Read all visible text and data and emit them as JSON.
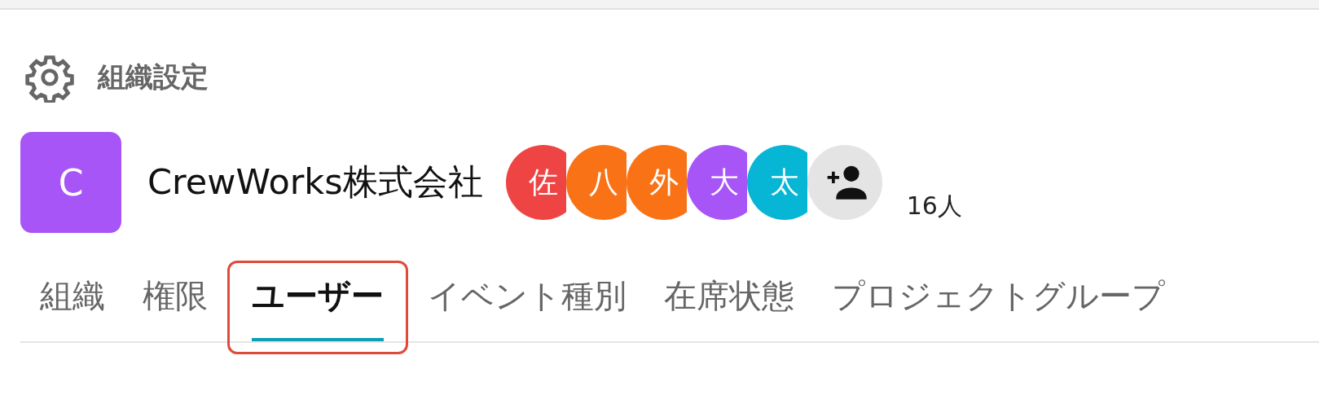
{
  "header": {
    "title": "組織設定"
  },
  "organization": {
    "logo_letter": "C",
    "name": "CrewWorks株式会社",
    "member_count": "16人"
  },
  "members": [
    {
      "initial": "佐",
      "color": "#ef4444"
    },
    {
      "initial": "八",
      "color": "#f97316"
    },
    {
      "initial": "外",
      "color": "#f97316"
    },
    {
      "initial": "大",
      "color": "#a855f7"
    },
    {
      "initial": "太",
      "color": "#06b6d4"
    }
  ],
  "tabs": [
    {
      "label": "組織",
      "selected": false,
      "highlighted": false
    },
    {
      "label": "権限",
      "selected": false,
      "highlighted": false
    },
    {
      "label": "ユーザー",
      "selected": true,
      "highlighted": true
    },
    {
      "label": "イベント種別",
      "selected": false,
      "highlighted": false
    },
    {
      "label": "在席状態",
      "selected": false,
      "highlighted": false
    },
    {
      "label": "プロジェクトグループ",
      "selected": false,
      "highlighted": false
    }
  ]
}
